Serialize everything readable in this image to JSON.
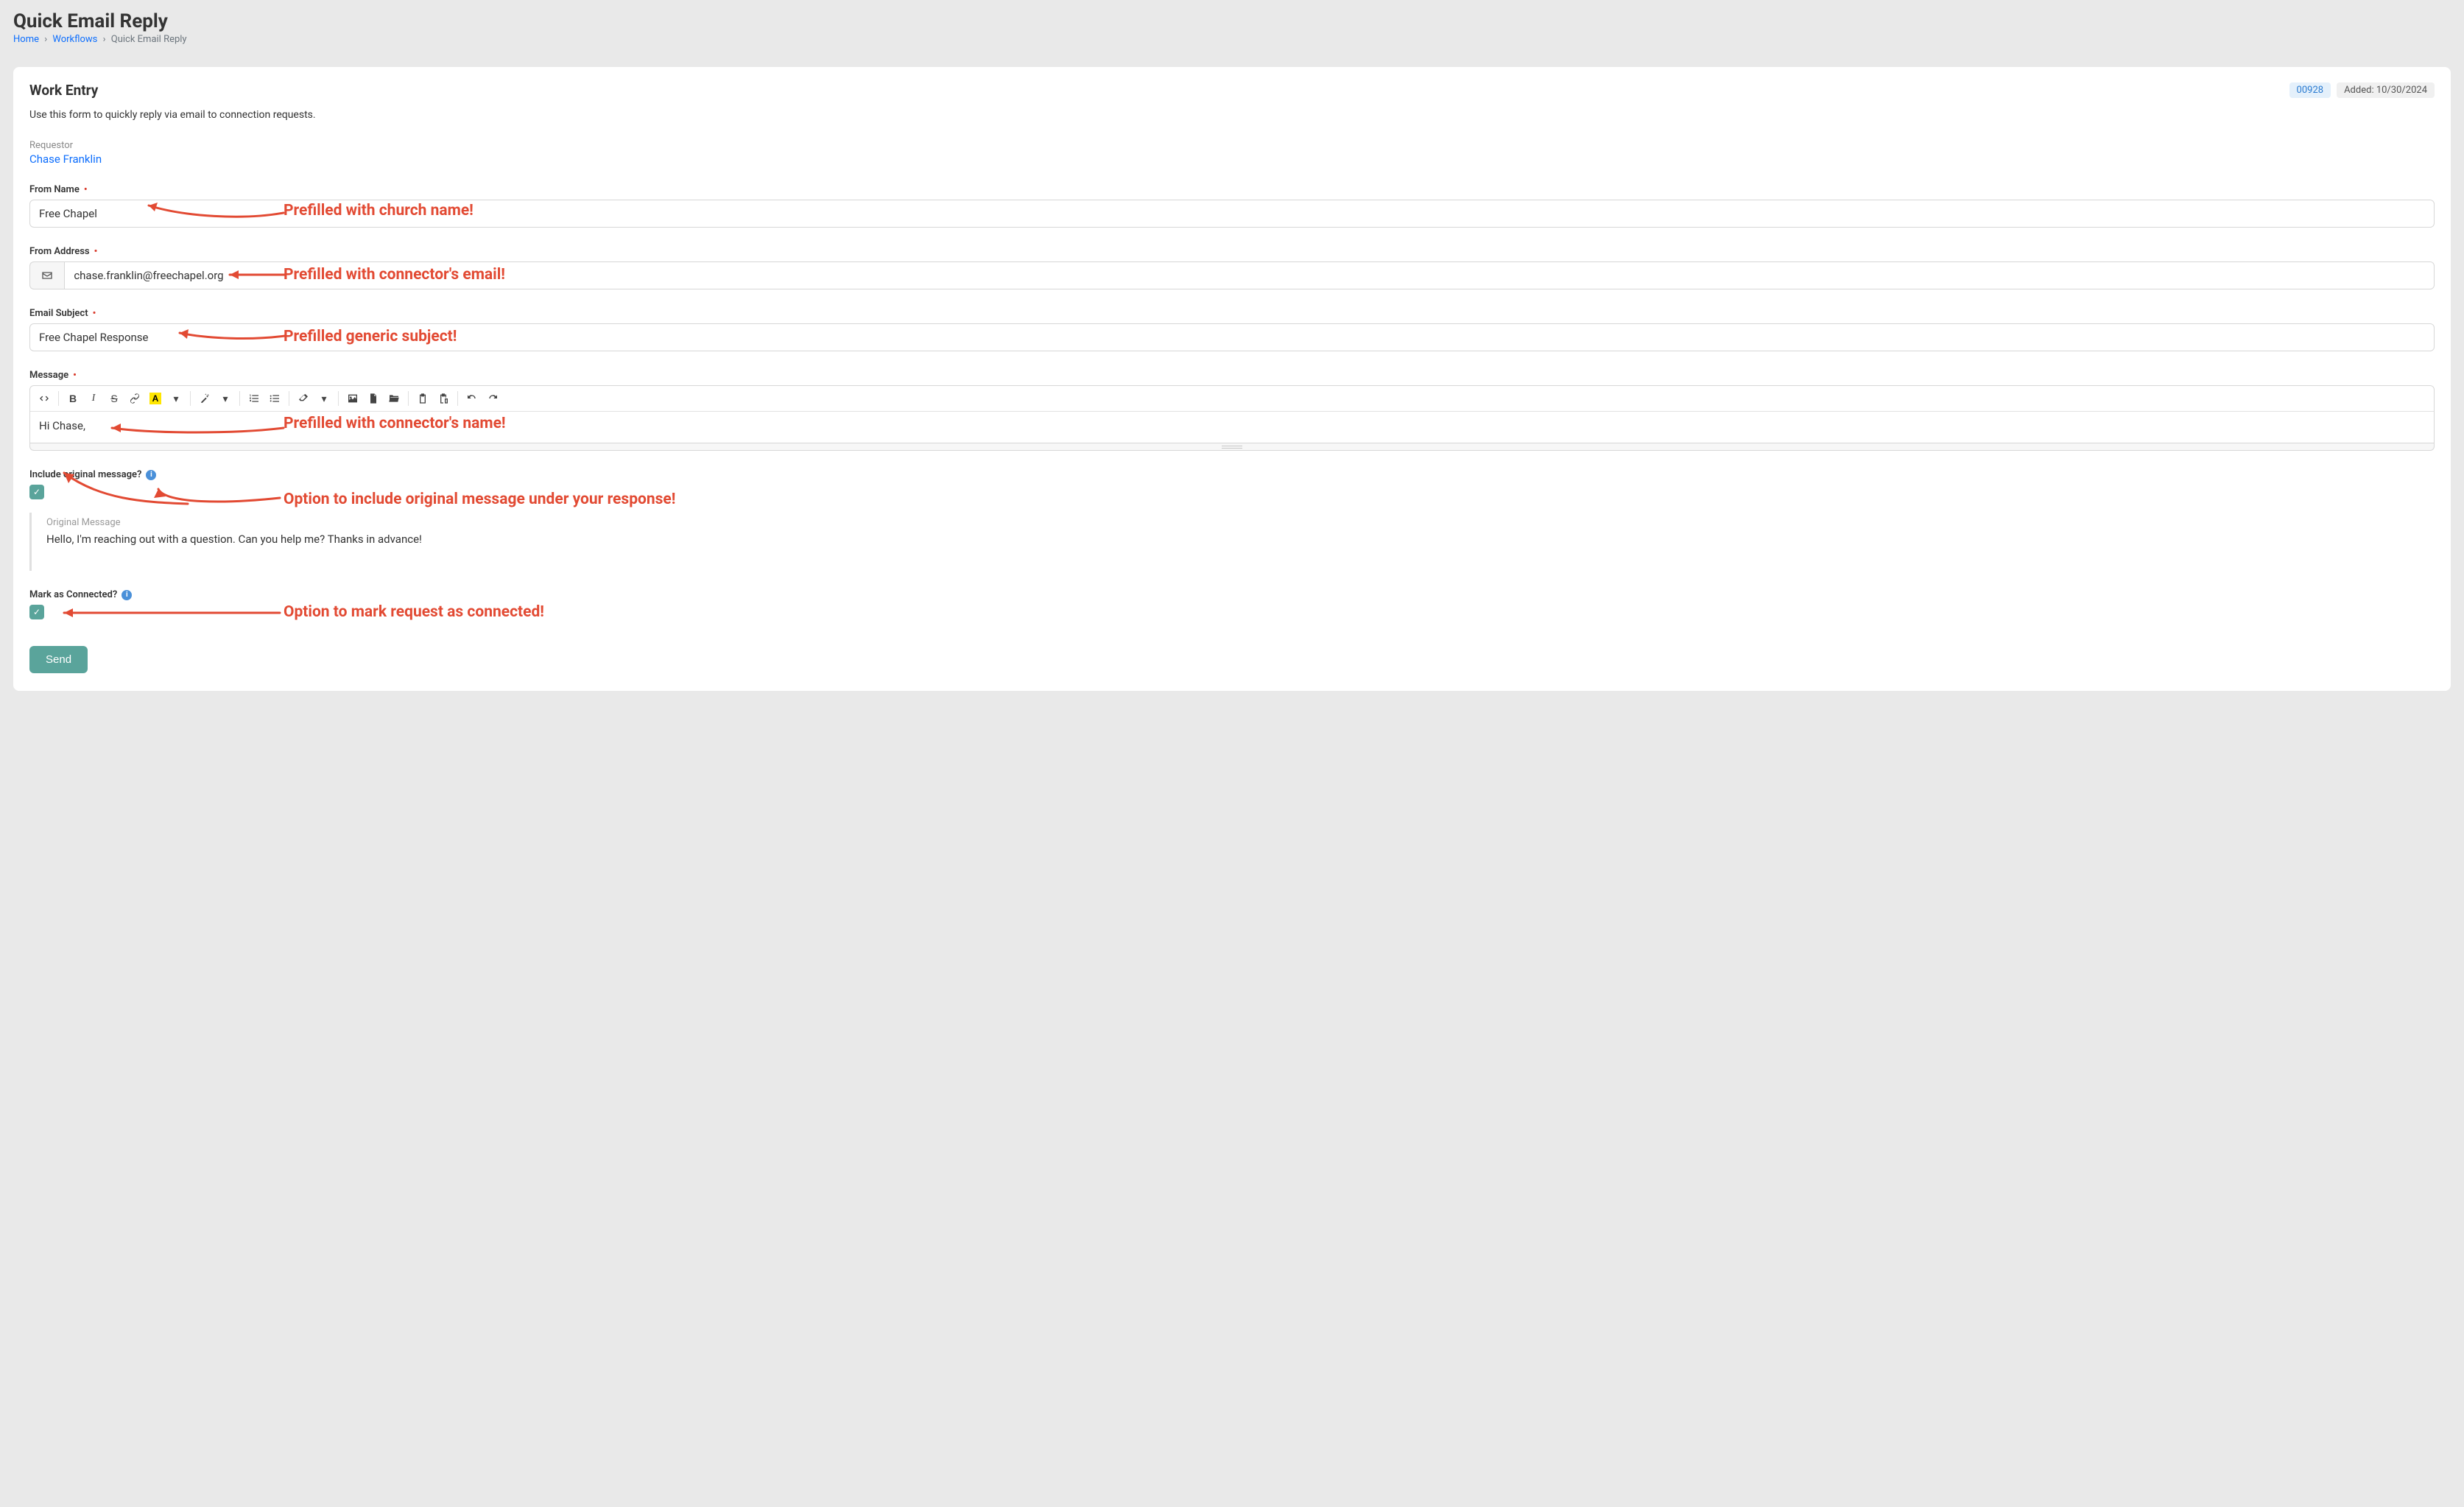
{
  "page": {
    "title": "Quick Email Reply"
  },
  "breadcrumb": {
    "home": "Home",
    "workflows": "Workflows",
    "current": "Quick Email Reply"
  },
  "panel": {
    "title": "Work Entry",
    "badge_id": "00928",
    "badge_added": "Added: 10/30/2024",
    "intro": "Use this form to quickly reply via email to connection requests."
  },
  "requestor": {
    "label": "Requestor",
    "name": "Chase Franklin"
  },
  "form": {
    "from_name": {
      "label": "From Name",
      "value": "Free Chapel"
    },
    "from_address": {
      "label": "From Address",
      "value": "chase.franklin@freechapel.org"
    },
    "subject": {
      "label": "Email Subject",
      "value": "Free Chapel Response"
    },
    "message": {
      "label": "Message",
      "value": "Hi Chase,"
    },
    "include_original": {
      "label": "Include original message?"
    },
    "original_message": {
      "title": "Original Message",
      "text": "Hello, I'm reaching out with a question. Can you help me? Thanks in advance!"
    },
    "mark_connected": {
      "label": "Mark as Connected?"
    },
    "send": "Send"
  },
  "annotations": {
    "a1": "Prefilled with church name!",
    "a2": "Prefilled with connector's email!",
    "a3": "Prefilled generic subject!",
    "a4": "Prefilled with connector's name!",
    "a5": "Option to include original message under your response!",
    "a6": "Option to mark request as connected!"
  }
}
